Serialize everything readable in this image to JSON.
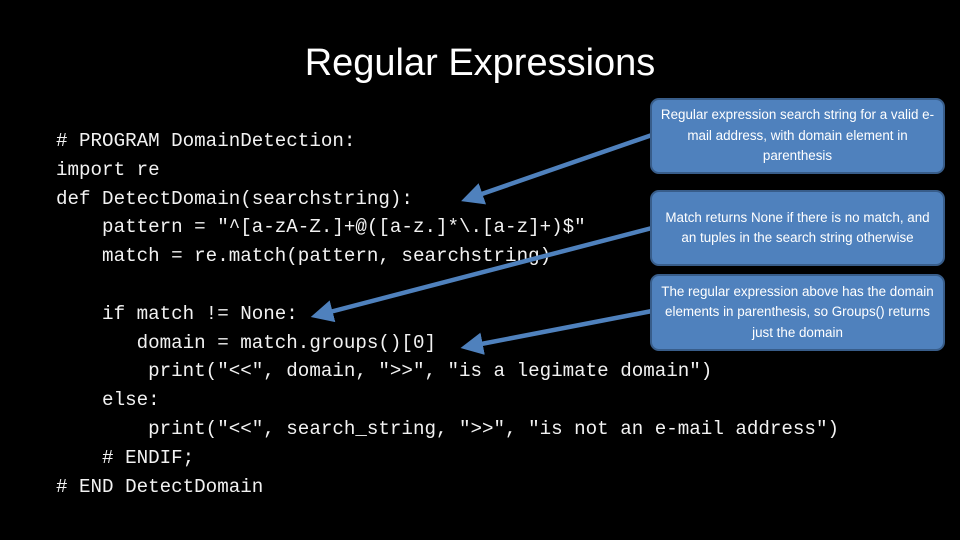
{
  "slide": {
    "title": "Regular Expressions"
  },
  "code": {
    "lines": [
      "# PROGRAM DomainDetection:",
      "import re",
      "def DetectDomain(searchstring):",
      "    pattern = \"^[a-zA-Z.]+@([a-z.]*\\.[a-z]+)$\"",
      "    match = re.match(pattern, searchstring)",
      "",
      "    if match != None:",
      "       domain = match.groups()[0]",
      "        print(\"<<\", domain, \">>\", \"is a legimate domain\")",
      "    else:",
      "        print(\"<<\", search_string, \">>\", \"is not an e-mail address\")",
      "    # ENDIF;",
      "# END DetectDomain"
    ]
  },
  "callouts": [
    {
      "text": "Regular expression search string for a valid e-mail address, with domain element in parenthesis"
    },
    {
      "text": "Match returns None if there is no match, and an tuples in the search string otherwise"
    },
    {
      "text": "The regular expression above has the domain elements in parenthesis, so Groups() returns just the domain"
    }
  ],
  "colors": {
    "background": "#000000",
    "callout_fill": "#4f81bd",
    "callout_border": "#385d8a",
    "arrow": "#4f81bd",
    "text": "#ffffff"
  }
}
